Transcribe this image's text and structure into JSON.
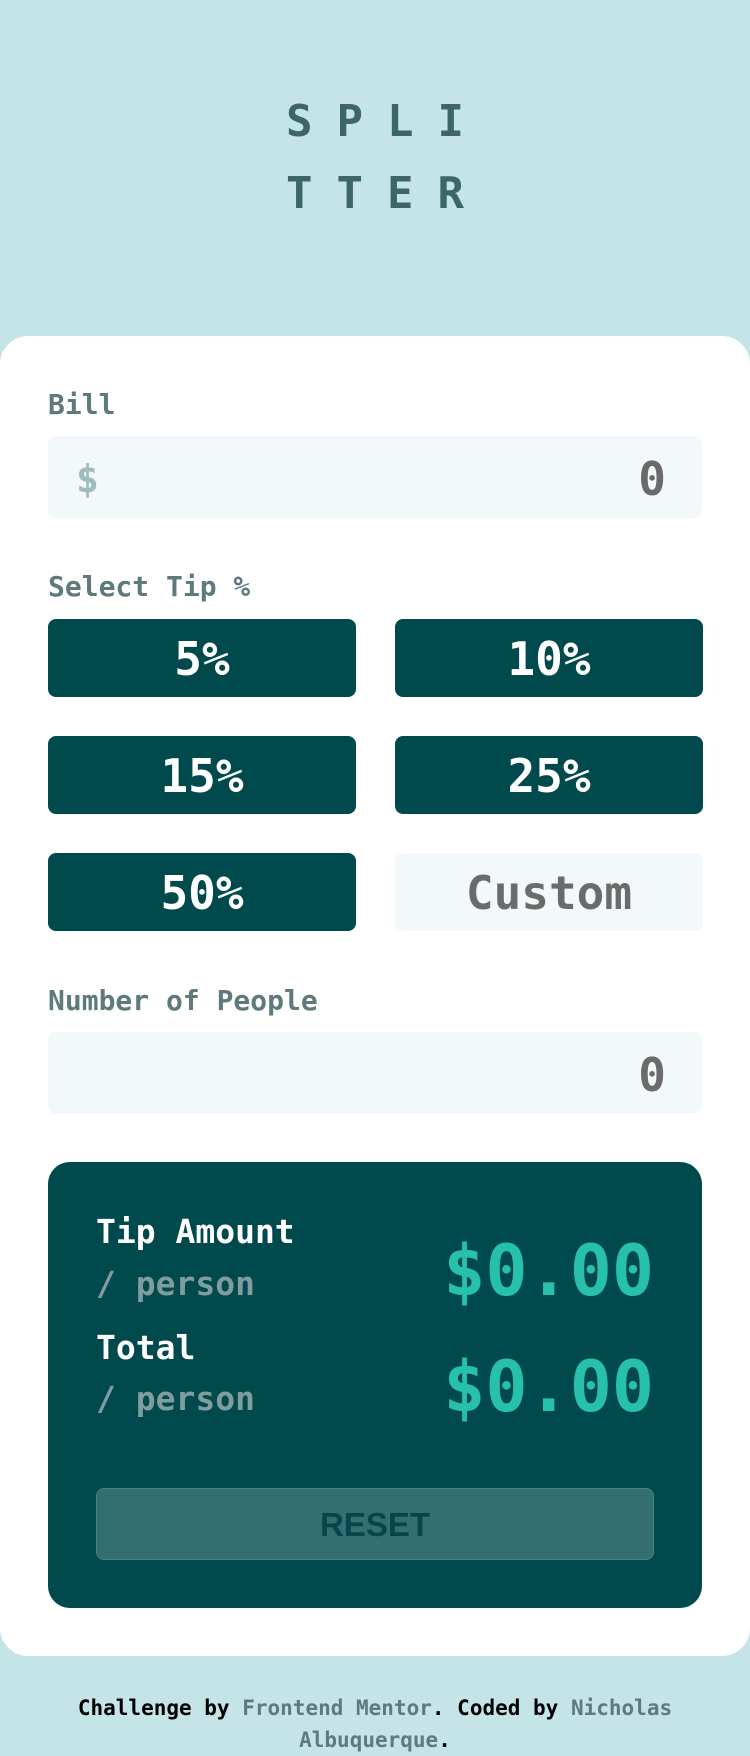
{
  "logo": {
    "line1": "SPLI",
    "line2": "TTER"
  },
  "bill": {
    "label": "Bill",
    "currency_symbol": "$",
    "value": "0"
  },
  "tip": {
    "label": "Select Tip %",
    "options": [
      "5%",
      "10%",
      "15%",
      "25%",
      "50%"
    ],
    "custom_placeholder": "Custom"
  },
  "people": {
    "label": "Number of People",
    "value": "0"
  },
  "results": {
    "tip_amount_label": "Tip Amount",
    "tip_amount_sub": "/ person",
    "tip_amount_value": "$0.00",
    "total_label": "Total",
    "total_sub": "/ person",
    "total_value": "$0.00",
    "reset_label": "RESET"
  },
  "footer": {
    "prefix": "Challenge by ",
    "link1": "Frontend Mentor",
    "middle": ". Coded by ",
    "link2": "Nicholas Albuquerque",
    "suffix": "."
  },
  "colors": {
    "background": "#c5e4e7",
    "dark_cyan": "#00494d",
    "strong_cyan": "#26c0ab",
    "grayish_cyan": "#5e7a7d"
  }
}
